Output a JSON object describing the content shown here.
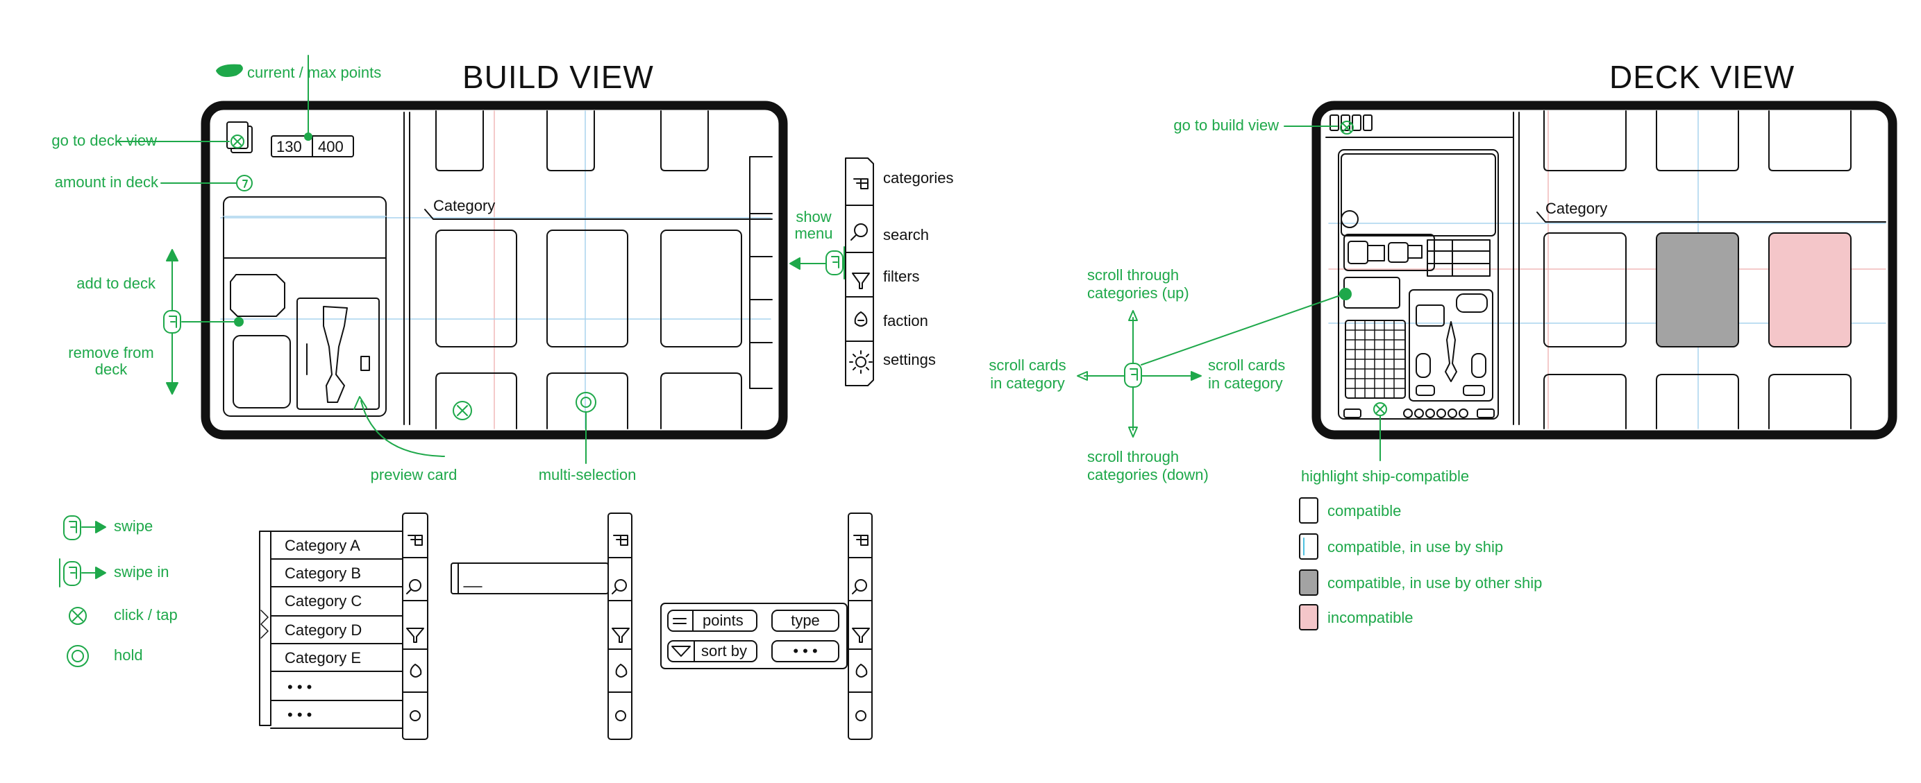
{
  "build_view": {
    "title": "BUILD VIEW",
    "points": {
      "current": "130",
      "max": "400"
    },
    "category_label": "Category",
    "annotations": {
      "current_max_points": "current / max points",
      "go_to_deck_view": "go to deck view",
      "amount_in_deck": "amount in deck",
      "add_to_deck": "add to deck",
      "remove_from_deck_line1": "remove from",
      "remove_from_deck_line2": "deck",
      "preview_card": "preview card",
      "multi_selection": "multi-selection",
      "show_menu_line1": "show",
      "show_menu_line2": "menu"
    },
    "menu_items": [
      "categories",
      "search",
      "filters",
      "faction",
      "settings"
    ]
  },
  "legend": {
    "swipe": "swipe",
    "swipe_in": "swipe in",
    "click_tap": "click / tap",
    "hold": "hold"
  },
  "category_list": [
    "Category A",
    "Category B",
    "Category C",
    "Category D",
    "Category E",
    "• • •",
    "• • •"
  ],
  "filter_panel": {
    "points": "points",
    "type": "type",
    "sort_by": "sort by",
    "more": "• • •"
  },
  "deck_view": {
    "title": "DECK VIEW",
    "category_label": "Category",
    "annotations": {
      "go_to_build_view": "go to build view",
      "scroll_up_line1": "scroll through",
      "scroll_up_line2": "categories (up)",
      "scroll_down_line1": "scroll through",
      "scroll_down_line2": "categories (down)",
      "scroll_left_line1": "scroll cards",
      "scroll_left_line2": "in category",
      "scroll_right_line1": "scroll cards",
      "scroll_right_line2": "in category",
      "highlight": "highlight  ship-compatible"
    },
    "compat_legend": [
      {
        "label": "compatible",
        "color": "#ffffff"
      },
      {
        "label": "compatible, in use by ship",
        "color": "#ffffff"
      },
      {
        "label": "compatible, in use by other ship",
        "color": "#a3a3a3"
      },
      {
        "label": "incompatible",
        "color": "#f4c6c9"
      }
    ]
  },
  "colors": {
    "annotation": "#1ea84a",
    "sketch": "#111111",
    "guide_blue": "#a9d4ee",
    "guide_red": "#f0b9b9"
  }
}
